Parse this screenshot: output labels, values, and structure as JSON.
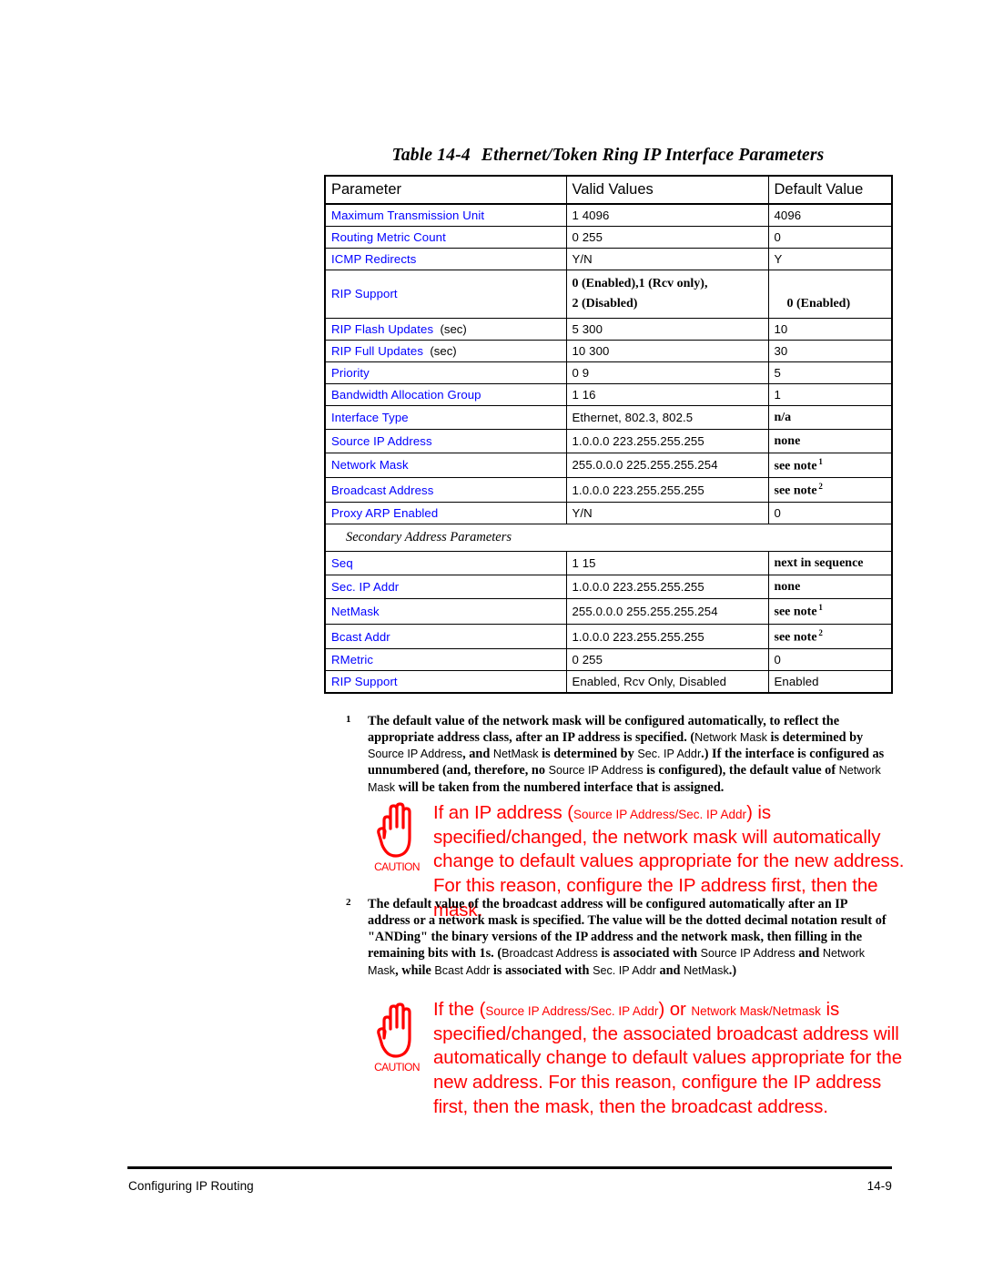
{
  "table": {
    "caption_number": "Table 14-4",
    "caption_title": "Ethernet/Token Ring IP Interface Parameters",
    "headers": {
      "parameter": "Parameter",
      "valid_values": "Valid Values",
      "default_value": "Default Value"
    },
    "section_label": "Secondary Address Parameters",
    "rows": [
      {
        "parameter": "Maximum Transmission Unit",
        "valid": "1 4096",
        "default": "4096"
      },
      {
        "parameter": "Routing Metric Count",
        "valid": "0 255",
        "default": "0"
      },
      {
        "parameter": "ICMP Redirects",
        "valid": "Y/N",
        "default": "Y"
      },
      {
        "parameter": "RIP Support",
        "valid_line1": "0 (Enabled),1 (Rcv only),",
        "valid_line2": "2 (Disabled)",
        "default": "0 (Enabled)"
      },
      {
        "parameter": "RIP Flash Updates",
        "suffix": "(sec)",
        "valid": "5 300",
        "default": "10"
      },
      {
        "parameter": "RIP Full Updates",
        "suffix": "(sec)",
        "valid": "10 300",
        "default": "30"
      },
      {
        "parameter": "Priority",
        "valid": "0 9",
        "default": "5"
      },
      {
        "parameter": "Bandwidth Allocation Group",
        "valid": "1 16",
        "default": "1"
      },
      {
        "parameter": "Interface Type",
        "valid": "Ethernet, 802.3, 802.5",
        "default": "n/a"
      },
      {
        "parameter": "Source IP Address",
        "valid": "1.0.0.0 223.255.255.255",
        "default": "none"
      },
      {
        "parameter": "Network Mask",
        "valid": "255.0.0.0 225.255.255.254",
        "default": "see note",
        "default_sup": "1"
      },
      {
        "parameter": "Broadcast Address",
        "valid": "1.0.0.0 223.255.255.255",
        "default": "see note",
        "default_sup": "2"
      },
      {
        "parameter": "Proxy ARP Enabled",
        "valid": "Y/N",
        "default": "0"
      },
      {
        "parameter": "Seq",
        "valid": "1 15",
        "default": "next in sequence"
      },
      {
        "parameter": "Sec. IP Addr",
        "valid": "1.0.0.0 223.255.255.255",
        "default": "none"
      },
      {
        "parameter": "NetMask",
        "valid": "255.0.0.0 255.255.255.254",
        "default": "see note",
        "default_sup": "1"
      },
      {
        "parameter": "Bcast Addr",
        "valid": "1.0.0.0 223.255.255.255",
        "default": "see note",
        "default_sup": "2"
      },
      {
        "parameter": "RMetric",
        "valid": "0 255",
        "default": "0"
      },
      {
        "parameter": "RIP Support",
        "valid": "Enabled, Rcv Only, Disabled",
        "default": "Enabled"
      }
    ]
  },
  "footnotes": [
    {
      "number": "1",
      "seg1": "The default value of the network mask will be configured automatically, to reflect the appropriate address class, after an IP address is specified. (",
      "p1": "Network Mask",
      "seg2": " is determined by ",
      "p2": "Source IP Address",
      "seg3": ", and ",
      "p3": "NetMask",
      "seg4": " is determined by ",
      "p4": "Sec. IP Addr",
      "seg5": ".) If the interface is configured as unnumbered (and, therefore, no ",
      "p5": "Source IP Address",
      "seg6": " is configured), the default value of ",
      "p6": "Network Mask",
      "seg7": " will be taken from the numbered interface that is assigned."
    },
    {
      "number": "2",
      "seg1": "The default value of the broadcast address will be configured automatically after an IP address or a network mask is specified. The value will be the dotted decimal notation result of \"ANDing\" the binary versions of the IP address and the network mask, then filling in the remaining bits with 1s. (",
      "p1": "Broadcast Address",
      "seg2": " is associated with ",
      "p2": "Source IP Address",
      "seg3": " and ",
      "p3": "Network Mask",
      "seg4": ", while ",
      "p4": "Bcast Addr",
      "seg5": " is associated with ",
      "p5": "Sec. IP Addr",
      "seg6": " and ",
      "p6": "NetMask",
      "seg7": ".)"
    }
  ],
  "cautions": [
    {
      "label": "CAUTION",
      "icon": "hand-stop-icon",
      "seg1": "If an IP address (",
      "param1": "Source IP Address/Sec. IP Addr",
      "seg2": ") is specified/changed, the network mask will automatically change to default values appropriate for the new address. For this reason, configure the IP address first, then the mask."
    },
    {
      "label": "CAUTION",
      "icon": "hand-stop-icon",
      "seg1": "If the (",
      "param1": "Source IP Address/Sec. IP Addr",
      "seg2": ") or ",
      "param2": "Network Mask/Netmask",
      "seg3": " is specified/changed, the associated broadcast address will automatically change to default values appropriate for the new address. For this reason, configure the IP address first, then the mask, then the broadcast address."
    }
  ],
  "footer": {
    "left": "Configuring IP Routing",
    "page": "14-9"
  },
  "colors": {
    "parameter_blue": "#0000ff",
    "caution_red": "#ff0000",
    "text_black": "#000000"
  }
}
